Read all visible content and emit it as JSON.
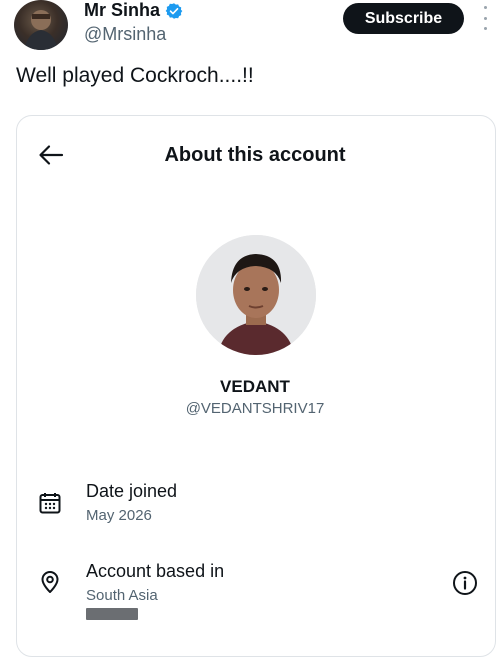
{
  "tweet": {
    "author_name": "Mr Sinha",
    "author_handle": "@Mrsinha",
    "subscribe_label": "Subscribe",
    "text": "Well played Cockroch....!!"
  },
  "about_card": {
    "title": "About this account",
    "profile_name": "VEDANT",
    "profile_handle": "@VEDANTSHRIV17",
    "rows": [
      {
        "icon": "calendar-icon",
        "label": "Date joined",
        "value": "May 2026"
      },
      {
        "icon": "location-pin-icon",
        "label": "Account based in",
        "value": "South Asia"
      }
    ]
  },
  "colors": {
    "verified_badge": "#1d9bf0",
    "subscribe_bg": "#0f1419",
    "secondary_text": "#536471"
  }
}
